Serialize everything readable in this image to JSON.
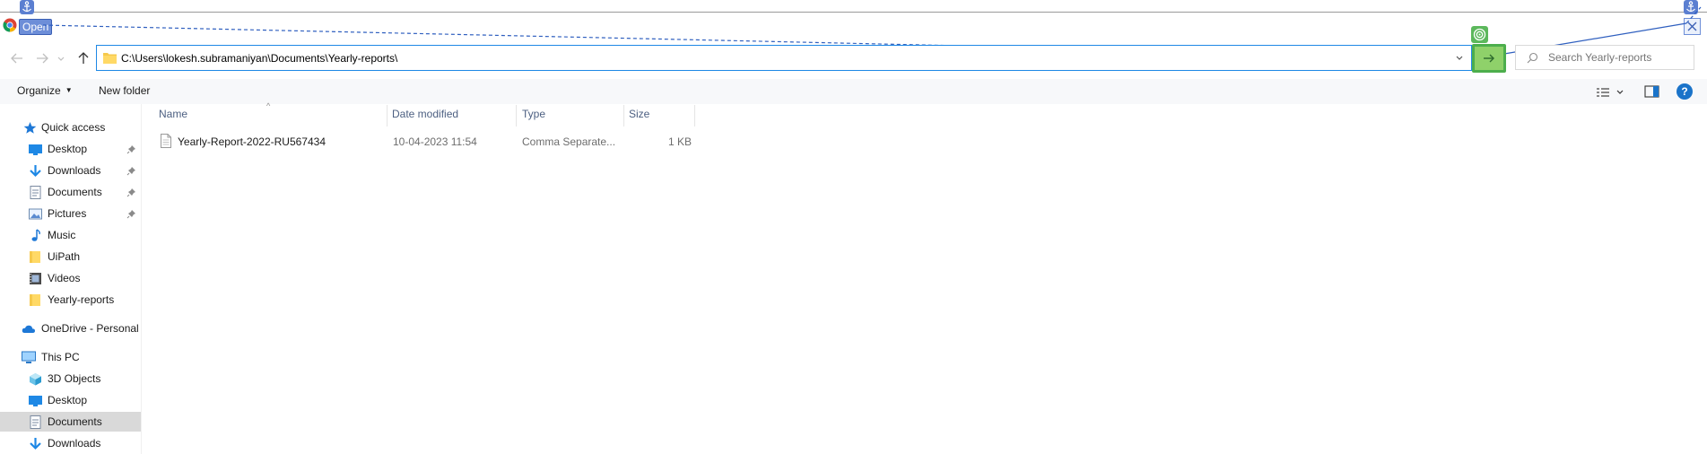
{
  "window": {
    "title": "Open"
  },
  "address_bar": {
    "path": "C:\\Users\\lokesh.subramaniyan\\Documents\\Yearly-reports\\"
  },
  "search": {
    "placeholder": "Search Yearly-reports"
  },
  "toolbar": {
    "organize": "Organize",
    "new_folder": "New folder",
    "help": "?"
  },
  "nav": {
    "quick_access": "Quick access",
    "quick_items": [
      {
        "label": "Desktop",
        "icon": "desktop-icon",
        "pinned": true
      },
      {
        "label": "Downloads",
        "icon": "downloads-icon",
        "pinned": true
      },
      {
        "label": "Documents",
        "icon": "documents-icon",
        "pinned": true
      },
      {
        "label": "Pictures",
        "icon": "pictures-icon",
        "pinned": true
      },
      {
        "label": "Music",
        "icon": "music-icon",
        "pinned": false
      },
      {
        "label": "UiPath",
        "icon": "folder-icon",
        "pinned": false
      },
      {
        "label": "Videos",
        "icon": "videos-icon",
        "pinned": false
      },
      {
        "label": "Yearly-reports",
        "icon": "folder-icon",
        "pinned": false
      }
    ],
    "onedrive": "OneDrive - Personal",
    "this_pc": "This PC",
    "pc_items": [
      {
        "label": "3D Objects",
        "icon": "3d-objects-icon"
      },
      {
        "label": "Desktop",
        "icon": "desktop-icon"
      },
      {
        "label": "Documents",
        "icon": "documents-icon",
        "selected": true
      },
      {
        "label": "Downloads",
        "icon": "downloads-icon"
      }
    ]
  },
  "columns": {
    "name": "Name",
    "date": "Date modified",
    "type": "Type",
    "size": "Size"
  },
  "files": [
    {
      "name": "Yearly-Report-2022-RU567434",
      "date": "10-04-2023 11:54",
      "type": "Comma Separate...",
      "size": "1 KB"
    }
  ],
  "colors": {
    "accent": "#1e88e5",
    "go_button": "#8fd16a",
    "anchor_badge": "#5b7fd1"
  }
}
